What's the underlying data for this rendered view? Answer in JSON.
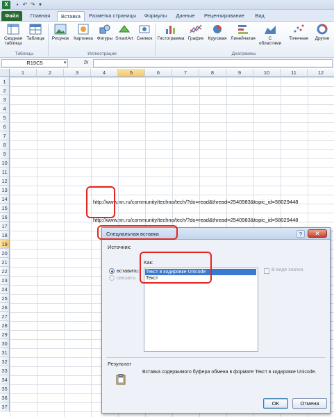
{
  "qat": {
    "logo": "X",
    "undo": "↶",
    "redo": "↷",
    "customize": "▾"
  },
  "tabs": [
    "Файл",
    "Главная",
    "Вставка",
    "Разметка страницы",
    "Формулы",
    "Данные",
    "Рецензирование",
    "Вид"
  ],
  "ribbon": {
    "buttons": [
      {
        "label": "Сводная\nтаблица",
        "icon": "pivot-table-icon"
      },
      {
        "label": "Таблица",
        "icon": "table-icon"
      },
      {
        "label": "Рисунок",
        "icon": "picture-icon"
      },
      {
        "label": "Картинка",
        "icon": "clipart-icon"
      },
      {
        "label": "Фигуры",
        "icon": "shapes-icon"
      },
      {
        "label": "SmartArt",
        "icon": "smartart-icon"
      },
      {
        "label": "Снимок",
        "icon": "screenshot-icon"
      },
      {
        "label": "Гистограмма",
        "icon": "column-chart-icon"
      },
      {
        "label": "График",
        "icon": "line-chart-icon"
      },
      {
        "label": "Круговая",
        "icon": "pie-chart-icon"
      },
      {
        "label": "Линейчатая",
        "icon": "bar-chart-icon"
      },
      {
        "label": "С\nобластями",
        "icon": "area-chart-icon"
      },
      {
        "label": "Точечная",
        "icon": "scatter-chart-icon"
      },
      {
        "label": "Другие",
        "icon": "other-charts-icon"
      }
    ],
    "groups": [
      "Таблицы",
      "Иллюстрации",
      "Диаграммы"
    ]
  },
  "formula_bar": {
    "name_box": "R19C5",
    "fx": "fx"
  },
  "columns": [
    "1",
    "2",
    "3",
    "4",
    "5",
    "6",
    "7",
    "8",
    "9",
    "10",
    "11",
    "12"
  ],
  "selected_column": "5",
  "rows": [
    "1",
    "2",
    "3",
    "4",
    "5",
    "6",
    "7",
    "8",
    "9",
    "10",
    "11",
    "12",
    "13",
    "14",
    "15",
    "16",
    "17",
    "18",
    "19",
    "20",
    "21",
    "22",
    "23",
    "24",
    "25",
    "26",
    "27",
    "28",
    "29",
    "30",
    "31",
    "32",
    "33",
    "34",
    "35",
    "36",
    "37"
  ],
  "selected_row": "19",
  "cells": {
    "r15": "http://www.nn.ru/community/techno/tech/?do=read&thread=2540983&topic_id=58029448",
    "r17": "http://www.nn.ru/community/techno/tech/?do=read&thread=2540983&topic_id=58029448"
  },
  "dialog": {
    "title": "Специальная вставка",
    "help": "?",
    "close": "✕",
    "source_label": "Источник:",
    "as_label": "Как:",
    "paste_label": "вставить:",
    "link_label": "связать:",
    "options": [
      "Текст в кодировке Unicode",
      "Текст"
    ],
    "display_as_icon": "В виде значка",
    "result_label": "Результат",
    "result_text": "Вставка содержимого буфера обмена в формате Текст в кодировке Unicode.",
    "ok": "OK",
    "cancel": "Отмена"
  },
  "colors": {
    "accent_red": "#e3231e",
    "selection": "#3a79d0",
    "file_tab": "#2a6a2f"
  }
}
